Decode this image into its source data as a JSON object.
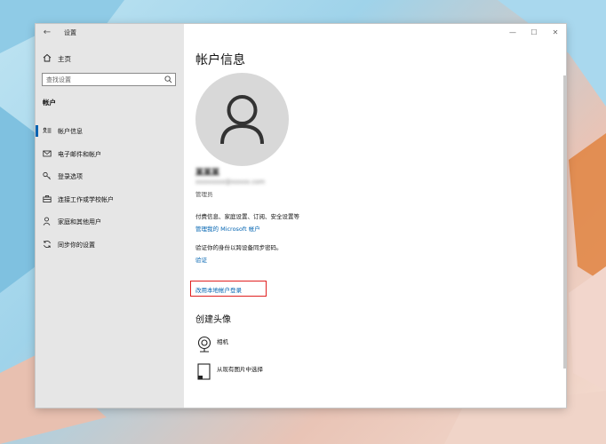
{
  "window": {
    "title": "设置",
    "controls": {
      "minimize": "—",
      "maximize": "☐",
      "close": "✕"
    }
  },
  "sidebar": {
    "home_label": "主页",
    "search": {
      "placeholder": "查找设置",
      "value": ""
    },
    "section_label": "帐户",
    "items": [
      {
        "label": "帐户信息",
        "icon": "account-info-icon",
        "active": true
      },
      {
        "label": "电子邮件和帐户",
        "icon": "mail-icon",
        "active": false
      },
      {
        "label": "登录选项",
        "icon": "key-icon",
        "active": false
      },
      {
        "label": "连接工作或学校帐户",
        "icon": "briefcase-icon",
        "active": false
      },
      {
        "label": "家庭和其他用户",
        "icon": "person-icon",
        "active": false
      },
      {
        "label": "同步你的设置",
        "icon": "sync-icon",
        "active": false
      }
    ]
  },
  "main": {
    "title": "帐户信息",
    "user": {
      "name": "某某某",
      "email": "xxxxxxxx@xxxxx.com",
      "role": "管理员"
    },
    "billing_text": "付费信息、家庭设置、订阅、安全设置等",
    "manage_link": "管理我的 Microsoft 帐户",
    "verify_text": "验证你的身份以跨设备同步密码。",
    "verify_link": "验证",
    "local_login_link": "改用本地帐户登录",
    "create_pic_title": "创建头像",
    "pic_options": [
      {
        "label": "相机",
        "icon": "camera-icon"
      },
      {
        "label": "从现有图片中选择",
        "icon": "browse-image-icon"
      }
    ]
  },
  "colors": {
    "accent": "#0063b1",
    "highlight_box": "#e02020"
  }
}
